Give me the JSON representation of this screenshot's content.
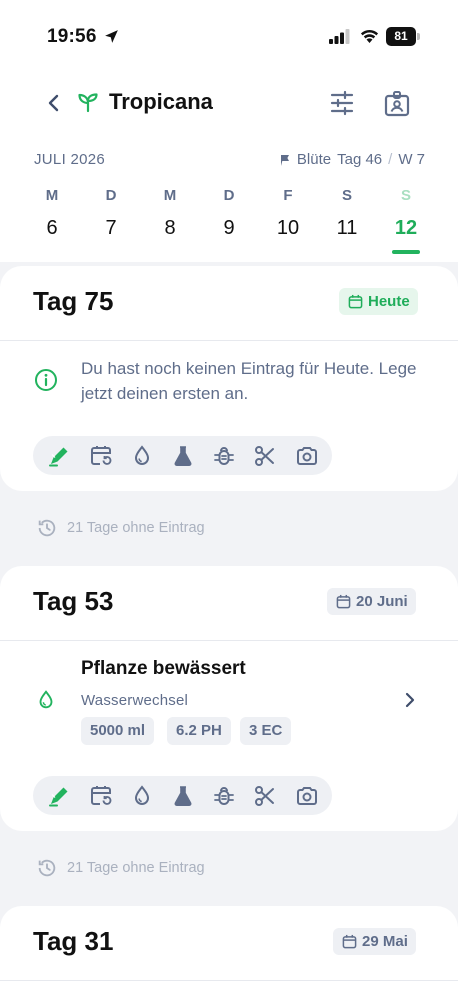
{
  "status_bar": {
    "time": "19:56",
    "battery": "81"
  },
  "header": {
    "title": "Tropicana",
    "back_icon": "chevron-left-icon",
    "filter_icon": "sliders-icon",
    "profile_icon": "id-badge-icon"
  },
  "calendar": {
    "month": "JULI 2026",
    "phase": "Blüte",
    "day_label": "Tag 46",
    "separator": "/",
    "week_label": "W 7",
    "days": [
      {
        "letter": "M",
        "number": "6"
      },
      {
        "letter": "D",
        "number": "7"
      },
      {
        "letter": "M",
        "number": "8"
      },
      {
        "letter": "D",
        "number": "9"
      },
      {
        "letter": "F",
        "number": "10"
      },
      {
        "letter": "S",
        "number": "11"
      },
      {
        "letter": "S",
        "number": "12",
        "active": true
      }
    ]
  },
  "cards": [
    {
      "title": "Tag 75",
      "badge": "Heute",
      "message": "Du hast noch keinen Eintrag für Heute. Lege jetzt deinen ersten an."
    },
    {
      "title": "Tag 53",
      "badge": "20 Juni",
      "entry": {
        "title": "Pflanze bewässert",
        "subtitle": "Wasserwechsel",
        "chips": [
          "5000 ml",
          "6.2 PH",
          "3 EC"
        ]
      }
    },
    {
      "title": "Tag 31",
      "badge": "29 Mai"
    }
  ],
  "gaps": [
    "21 Tage ohne Eintrag",
    "21 Tage ohne Eintrag"
  ],
  "toolbar_icons": [
    "edit-note-icon",
    "calendar-repeat-icon",
    "water-drop-icon",
    "flask-icon",
    "bug-icon",
    "scissors-icon",
    "camera-icon"
  ],
  "colors": {
    "accent": "#22b35e",
    "muted": "#5f6d8a",
    "background": "#f2f3f6"
  }
}
